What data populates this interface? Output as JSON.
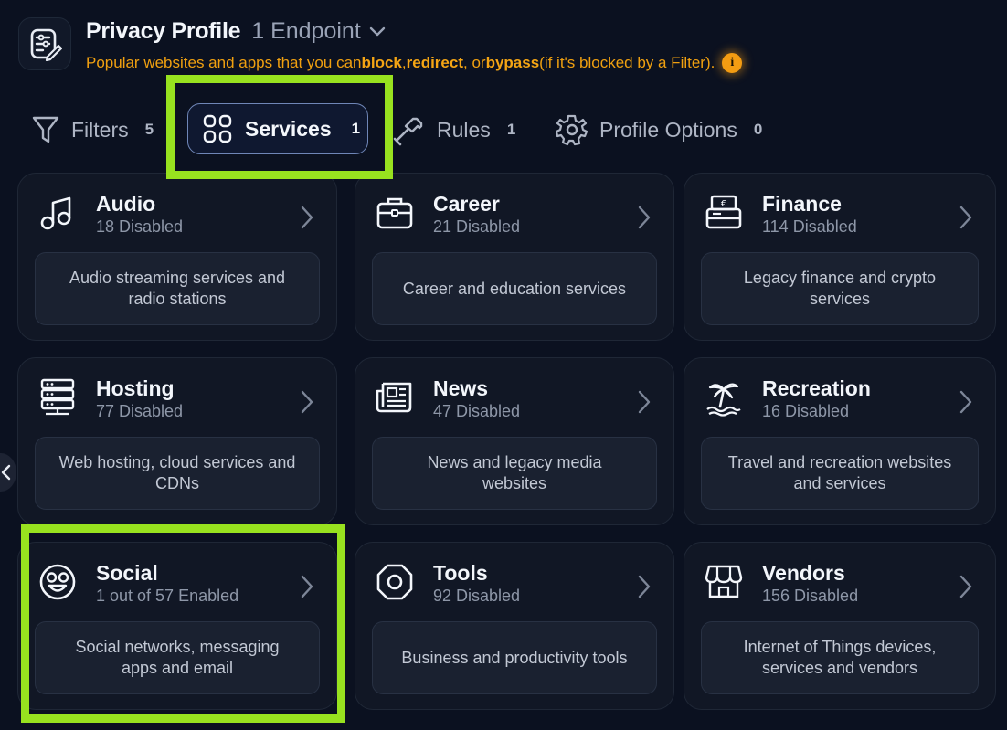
{
  "header": {
    "title": "Privacy Profile",
    "endpoint": "1 Endpoint",
    "subtitle_parts": [
      "Popular websites and apps that you can ",
      "block",
      ", ",
      "redirect",
      ", or ",
      "bypass",
      " (if it's blocked by a Filter)."
    ]
  },
  "tabs": [
    {
      "label": "Filters",
      "count": "5"
    },
    {
      "label": "Services",
      "count": "1",
      "active": true
    },
    {
      "label": "Rules",
      "count": "1"
    },
    {
      "label": "Profile Options",
      "count": "0"
    }
  ],
  "cards": [
    {
      "name": "Audio",
      "status": "18 Disabled",
      "desc": "Audio streaming services and radio stations",
      "icon": "music-note-icon"
    },
    {
      "name": "Career",
      "status": "21 Disabled",
      "desc": "Career and education services",
      "icon": "briefcase-icon"
    },
    {
      "name": "Finance",
      "status": "114 Disabled",
      "desc": "Legacy finance and crypto services",
      "icon": "cash-register-icon"
    },
    {
      "name": "Hosting",
      "status": "77 Disabled",
      "desc": "Web hosting, cloud services and CDNs",
      "icon": "server-icon"
    },
    {
      "name": "News",
      "status": "47 Disabled",
      "desc": "News and legacy media websites",
      "icon": "newspaper-icon"
    },
    {
      "name": "Recreation",
      "status": "16 Disabled",
      "desc": "Travel and recreation websites and services",
      "icon": "palm-tree-icon"
    },
    {
      "name": "Social",
      "status": "1 out of 57 Enabled",
      "desc": "Social networks, messaging apps and email",
      "icon": "smiley-icon"
    },
    {
      "name": "Tools",
      "status": "92 Disabled",
      "desc": "Business and productivity tools",
      "icon": "octagon-icon"
    },
    {
      "name": "Vendors",
      "status": "156 Disabled",
      "desc": "Internet of Things devices, services and vendors",
      "icon": "storefront-icon"
    }
  ],
  "colors": {
    "accent": "#f39c12",
    "highlight": "#98e21f",
    "background": "#0b1120",
    "card": "#111725"
  }
}
